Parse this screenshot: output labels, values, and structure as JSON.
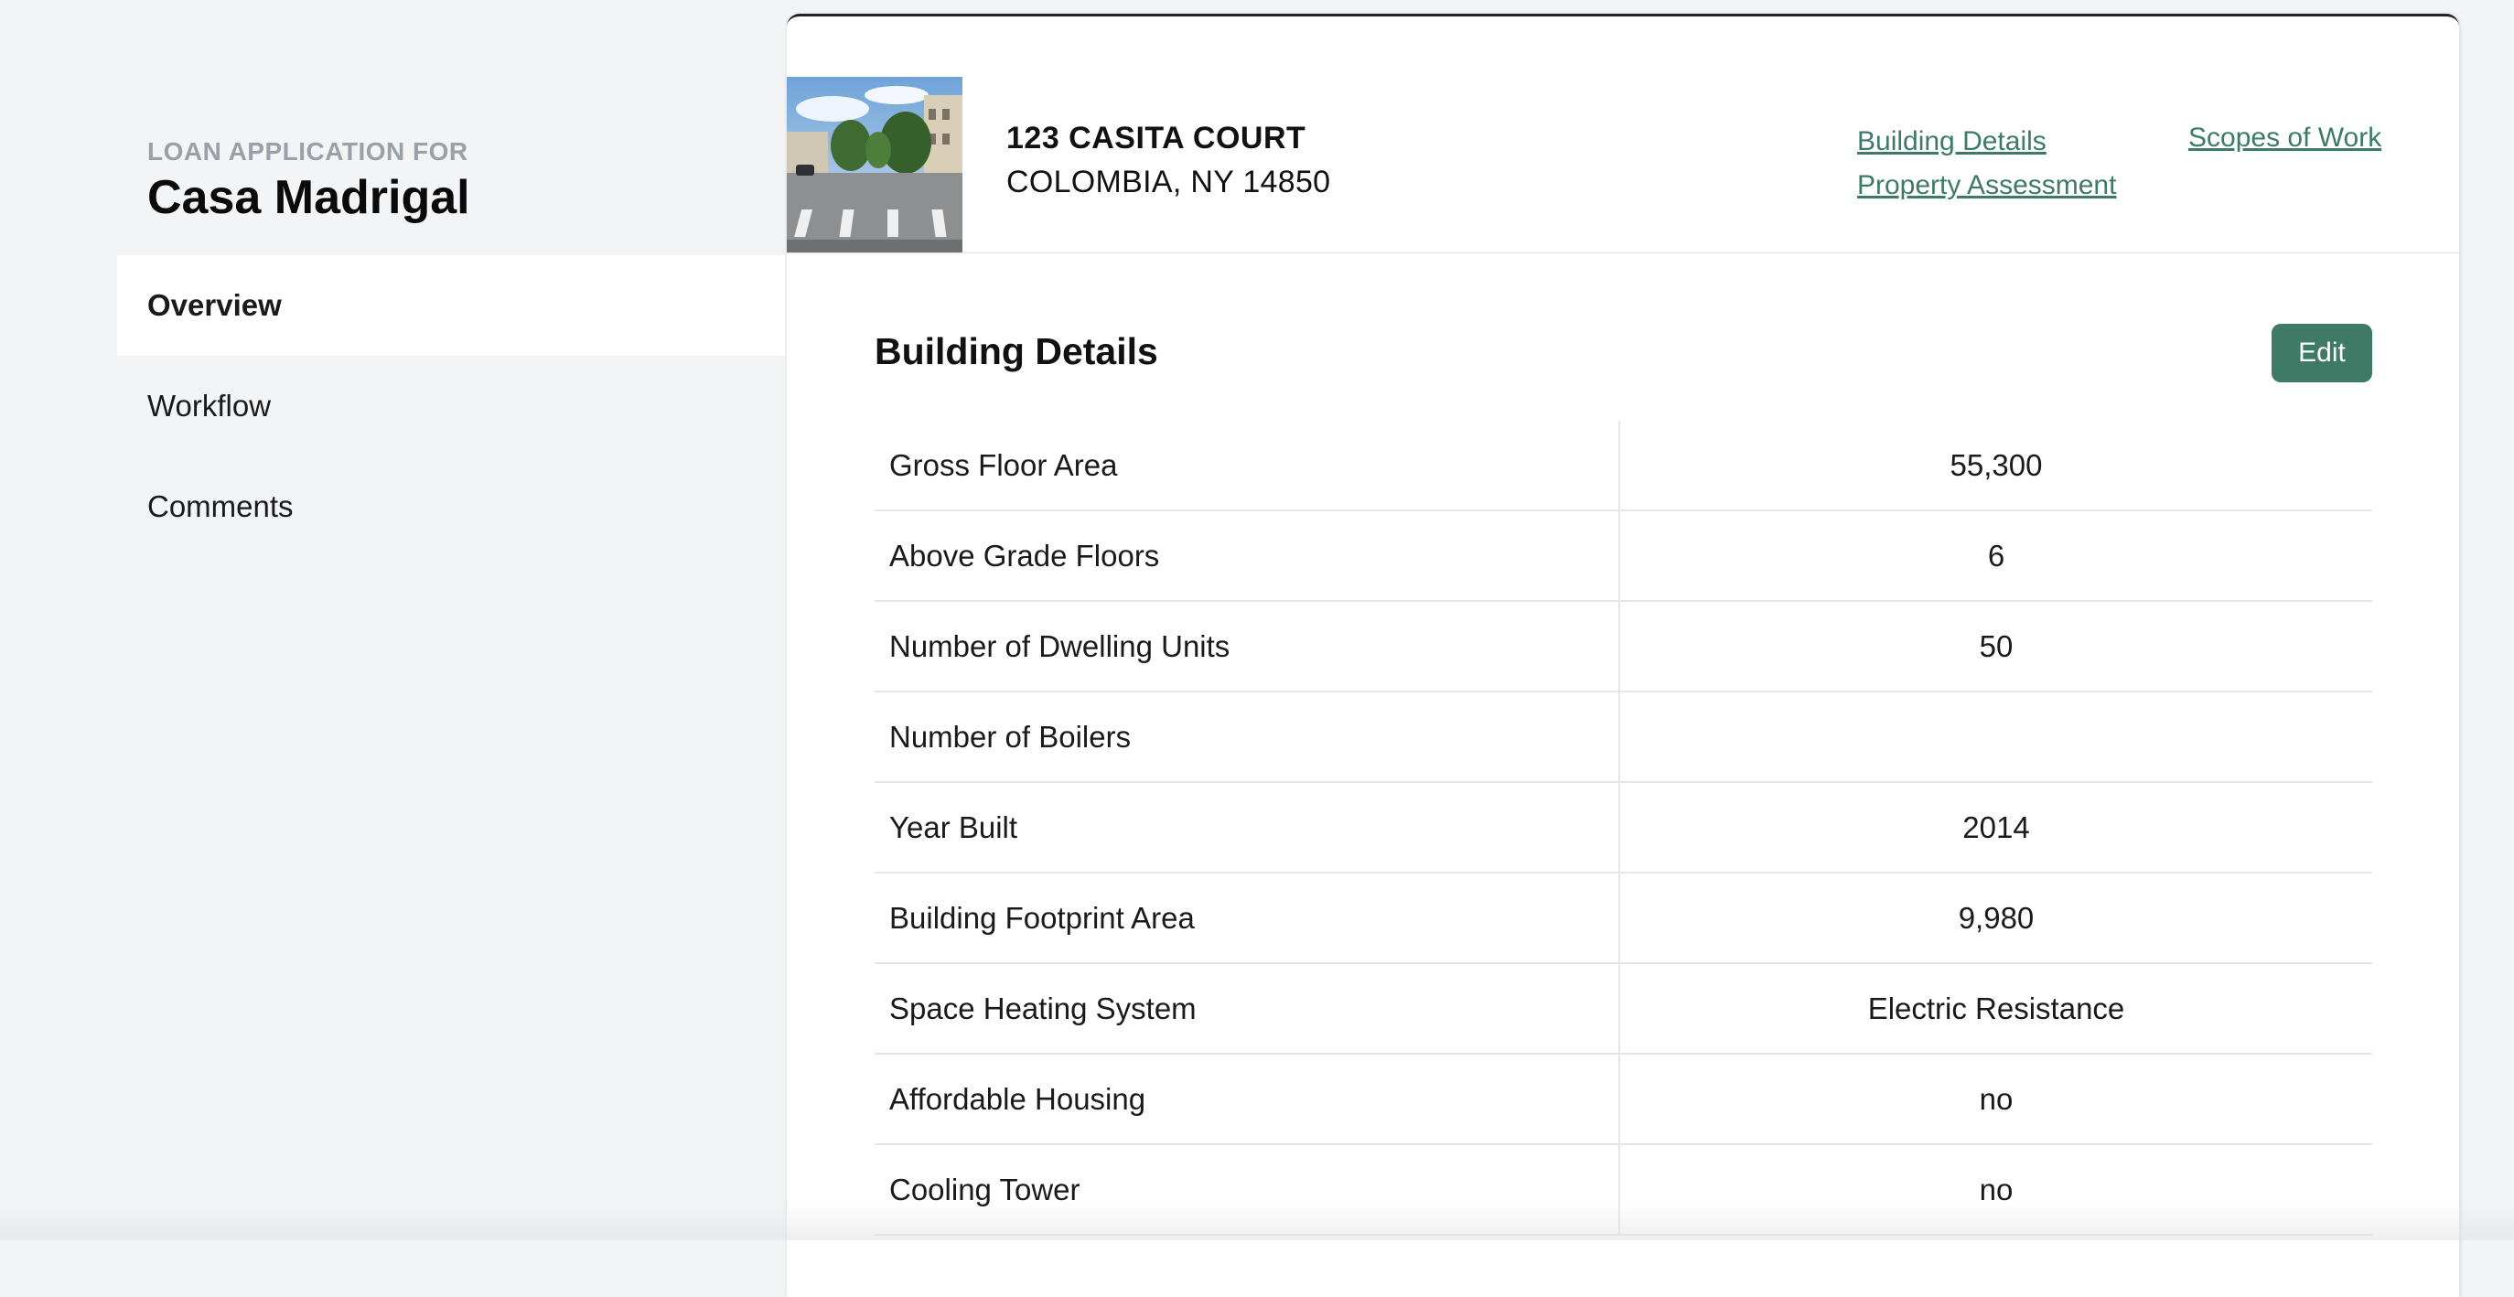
{
  "sidebar": {
    "eyebrow": "LOAN APPLICATION FOR",
    "title": "Casa Madrigal",
    "items": [
      {
        "label": "Overview",
        "active": true
      },
      {
        "label": "Workflow",
        "active": false
      },
      {
        "label": "Comments",
        "active": false
      }
    ]
  },
  "property": {
    "address_line1": "123 CASITA COURT",
    "address_line2": "COLOMBIA, NY 14850",
    "links": {
      "building_details": "Building Details",
      "property_assessment": "Property Assessment",
      "scopes_of_work": "Scopes of Work"
    }
  },
  "building_details": {
    "title": "Building Details",
    "edit_label": "Edit",
    "rows": [
      {
        "label": "Gross Floor Area",
        "value": "55,300"
      },
      {
        "label": "Above Grade Floors",
        "value": "6"
      },
      {
        "label": "Number of Dwelling Units",
        "value": "50"
      },
      {
        "label": "Number of Boilers",
        "value": ""
      },
      {
        "label": "Year Built",
        "value": "2014"
      },
      {
        "label": "Building Footprint Area",
        "value": "9,980"
      },
      {
        "label": "Space Heating System",
        "value": "Electric Resistance"
      },
      {
        "label": "Affordable Housing",
        "value": "no"
      },
      {
        "label": "Cooling Tower",
        "value": "no"
      }
    ]
  },
  "colors": {
    "accent": "#3e7a65",
    "link": "#3d7a68",
    "background": "#f3f4f6"
  }
}
